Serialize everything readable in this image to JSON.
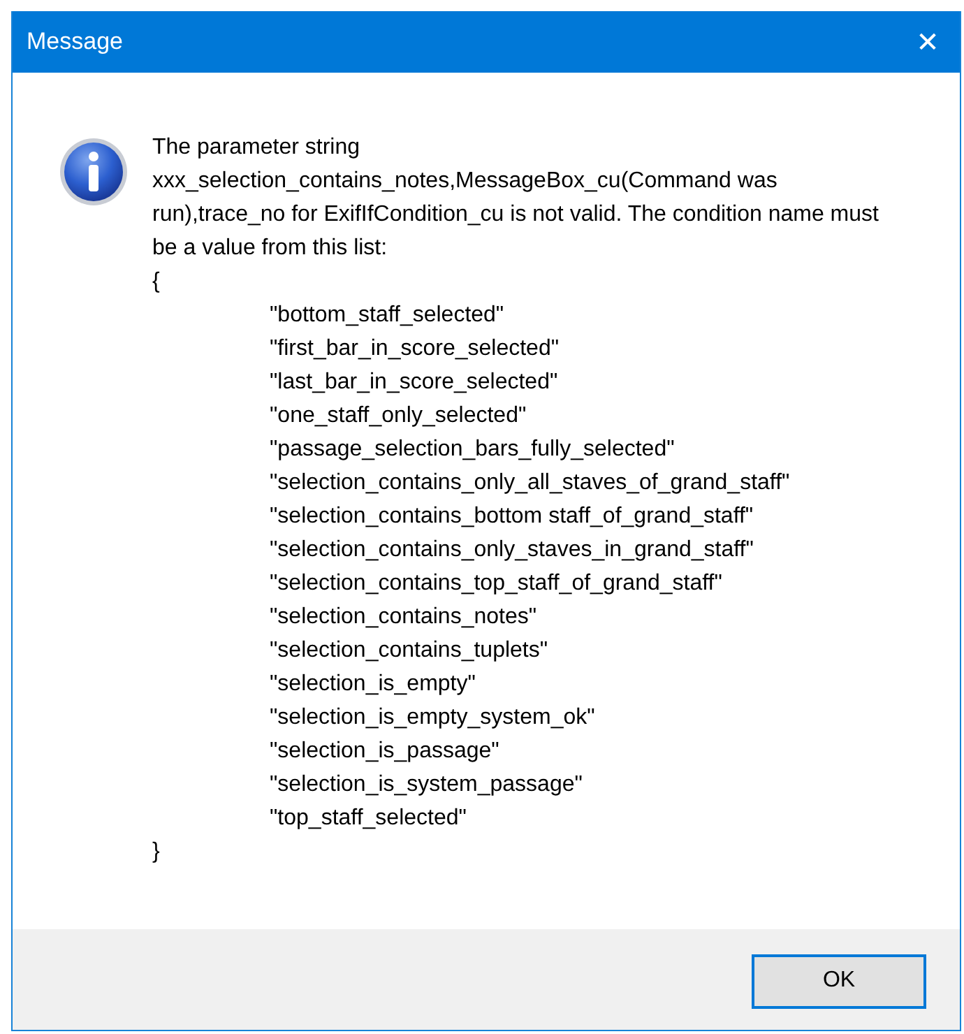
{
  "window": {
    "title": "Message",
    "close_glyph": "✕"
  },
  "message": {
    "text": "The parameter string xxx_selection_contains_notes,MessageBox_cu(Command was run),trace_no for ExifIfCondition_cu is not valid. The condition name must be a value from this list:",
    "open_brace": "{",
    "items": [
      "\"bottom_staff_selected\"",
      "\"first_bar_in_score_selected\"",
      "\"last_bar_in_score_selected\"",
      "\"one_staff_only_selected\"",
      "\"passage_selection_bars_fully_selected\"",
      "\"selection_contains_only_all_staves_of_grand_staff\"",
      "\"selection_contains_bottom staff_of_grand_staff\"",
      "\"selection_contains_only_staves_in_grand_staff\"",
      "\"selection_contains_top_staff_of_grand_staff\"",
      "\"selection_contains_notes\"",
      "\"selection_contains_tuplets\"",
      "\"selection_is_empty\"",
      "\"selection_is_empty_system_ok\"",
      "\"selection_is_passage\"",
      "\"selection_is_system_passage\"",
      "\"top_staff_selected\""
    ],
    "close_brace": "}"
  },
  "buttons": [
    "OK"
  ]
}
